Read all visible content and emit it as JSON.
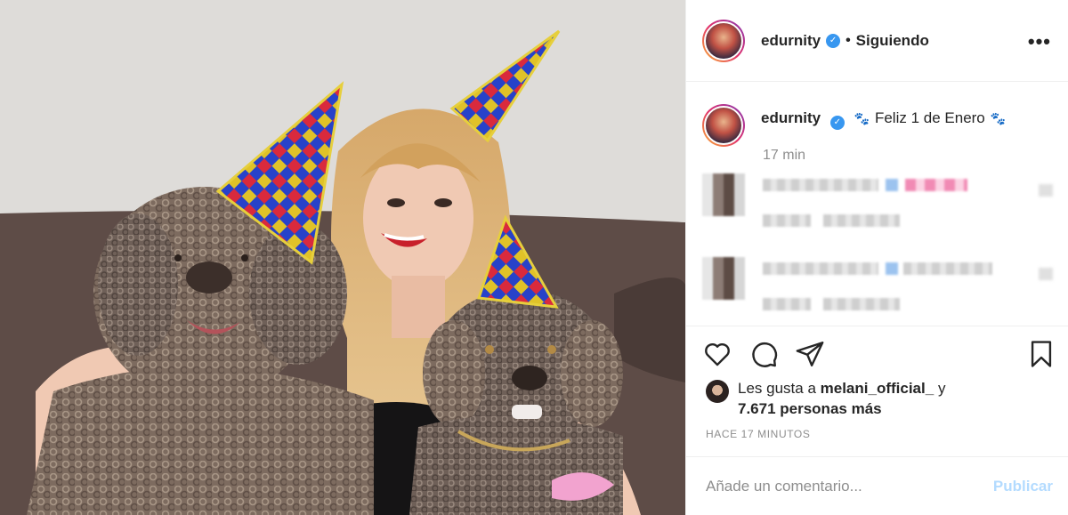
{
  "post": {
    "image_alt": "Edurne with two curly dogs wearing party hats"
  },
  "header": {
    "username": "edurnity",
    "verified_glyph": "✓",
    "separator": "•",
    "follow_status": "Siguiendo",
    "more_icon": "more-horizontal-icon",
    "more_glyph": "•••"
  },
  "caption": {
    "username": "edurnity",
    "emoji_left": "🐾",
    "text": "Feliz 1 de Enero",
    "emoji_right": "🐾",
    "time": "17 min"
  },
  "actions": {
    "icons": [
      "heart-icon",
      "comment-icon",
      "share-icon",
      "bookmark-icon"
    ]
  },
  "likes": {
    "prefix": "Les gusta a",
    "user": "melani_official_",
    "connector": "y",
    "count_text": "7.671 personas más"
  },
  "timestamp": "HACE 17 MINUTOS",
  "comment_box": {
    "placeholder": "Añade un comentario...",
    "publish_label": "Publicar"
  },
  "colors": {
    "verified": "#3897f0",
    "publish_disabled": "#b3dbff",
    "muted": "#8e8e8e",
    "text": "#262626"
  }
}
